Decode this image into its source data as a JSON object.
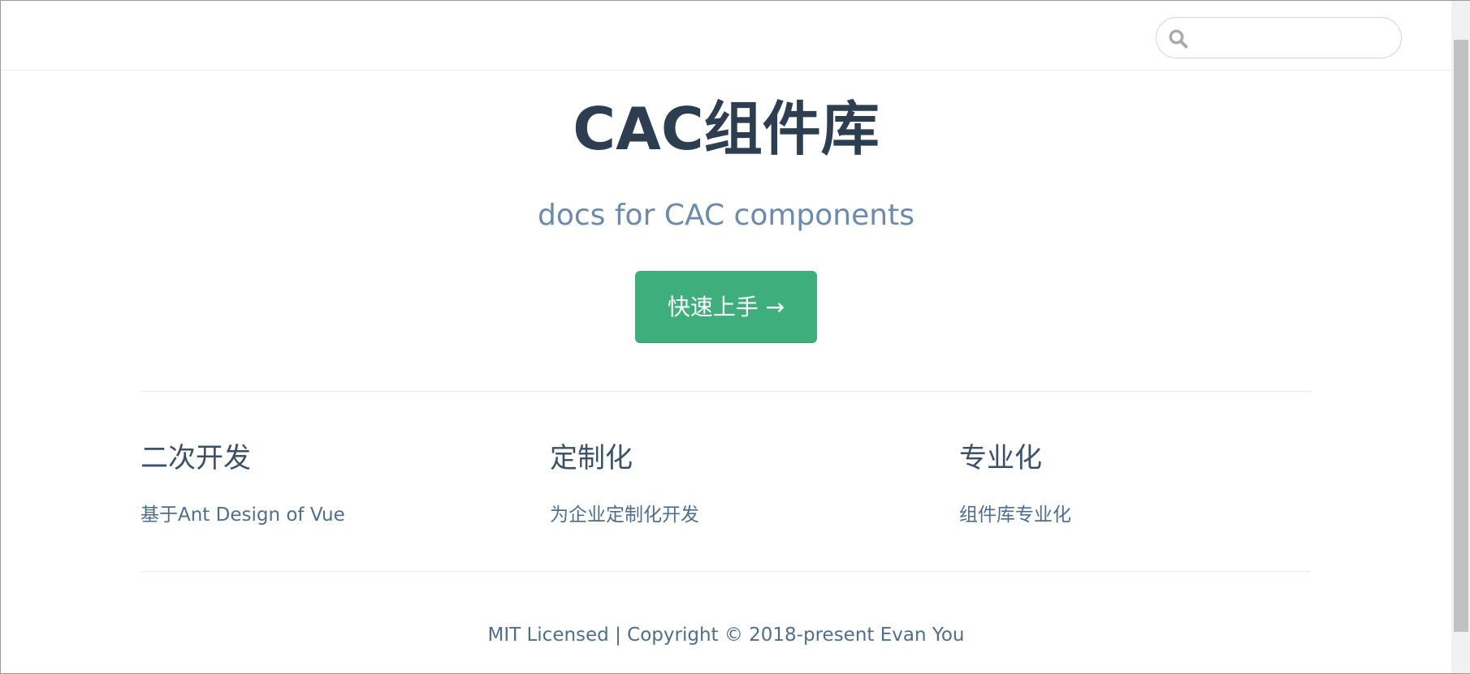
{
  "search": {
    "value": "",
    "placeholder": ""
  },
  "hero": {
    "title": "CAC组件库",
    "description": "docs for CAC components",
    "action_label": "快速上手 →"
  },
  "features": [
    {
      "title": "二次开发",
      "details": "基于Ant Design of Vue"
    },
    {
      "title": "定制化",
      "details": "为企业定制化开发"
    },
    {
      "title": "专业化",
      "details": "组件库专业化"
    }
  ],
  "footer": {
    "text": "MIT Licensed | Copyright © 2018-present Evan You"
  },
  "colors": {
    "accent": "#3eaf7c",
    "text": "#2c3e50",
    "description": "#6a8bad",
    "details": "#4e6e8e",
    "border": "#eaecef"
  },
  "icons": {
    "search": "search-icon"
  }
}
